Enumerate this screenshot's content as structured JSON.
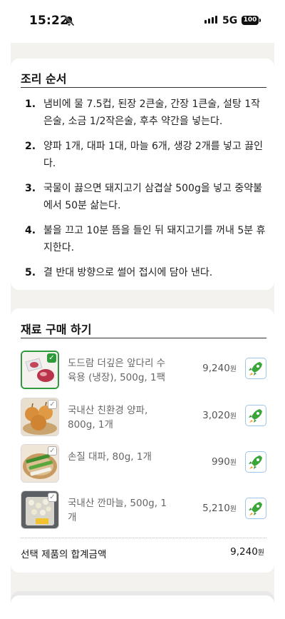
{
  "status_bar": {
    "time": "15:22",
    "network": "5G",
    "battery": "100"
  },
  "recipe": {
    "title": "조리 순서",
    "steps": [
      {
        "num": "1.",
        "text": "냄비에 물 7.5컵, 된장 2큰술, 간장 1큰술, 설탕 1작은술, 소금 1/2작은술, 후추 약간을 넣는다."
      },
      {
        "num": "2.",
        "text": "양파 1개, 대파 1대, 마늘 6개, 생강 2개를 넣고 끓인다."
      },
      {
        "num": "3.",
        "text": "국물이 끓으면 돼지고기 삼겹살 500g을 넣고 중약불에서 50분 삶는다."
      },
      {
        "num": "4.",
        "text": "불을 끄고 10분 뜸을 들인 뒤 돼지고기를 꺼내 5분 휴지한다."
      },
      {
        "num": "5.",
        "text": "결 반대 방향으로 썰어 접시에 담아 낸다."
      }
    ]
  },
  "shop": {
    "title": "재료 구매 하기",
    "currency": "원",
    "products": [
      {
        "name": "도드람 더깊은 앞다리 수육용 (냉장), 500g, 1팩",
        "price": "9,240",
        "selected": true,
        "icon": "pork-meat-image"
      },
      {
        "name": "국내산 친환경 양파, 800g, 1개",
        "price": "3,020",
        "selected": false,
        "icon": "onion-image"
      },
      {
        "name": "손질 대파, 80g, 1개",
        "price": "990",
        "selected": false,
        "icon": "green-onion-image"
      },
      {
        "name": "국내산 깐마늘, 500g, 1개",
        "price": "5,210",
        "selected": false,
        "icon": "garlic-image"
      }
    ],
    "total_label": "선택 제품의 합계금액",
    "total_value": "9,240"
  },
  "colors": {
    "accent_green": "#2e9a3a",
    "rocket_border": "#9fc6e8"
  }
}
